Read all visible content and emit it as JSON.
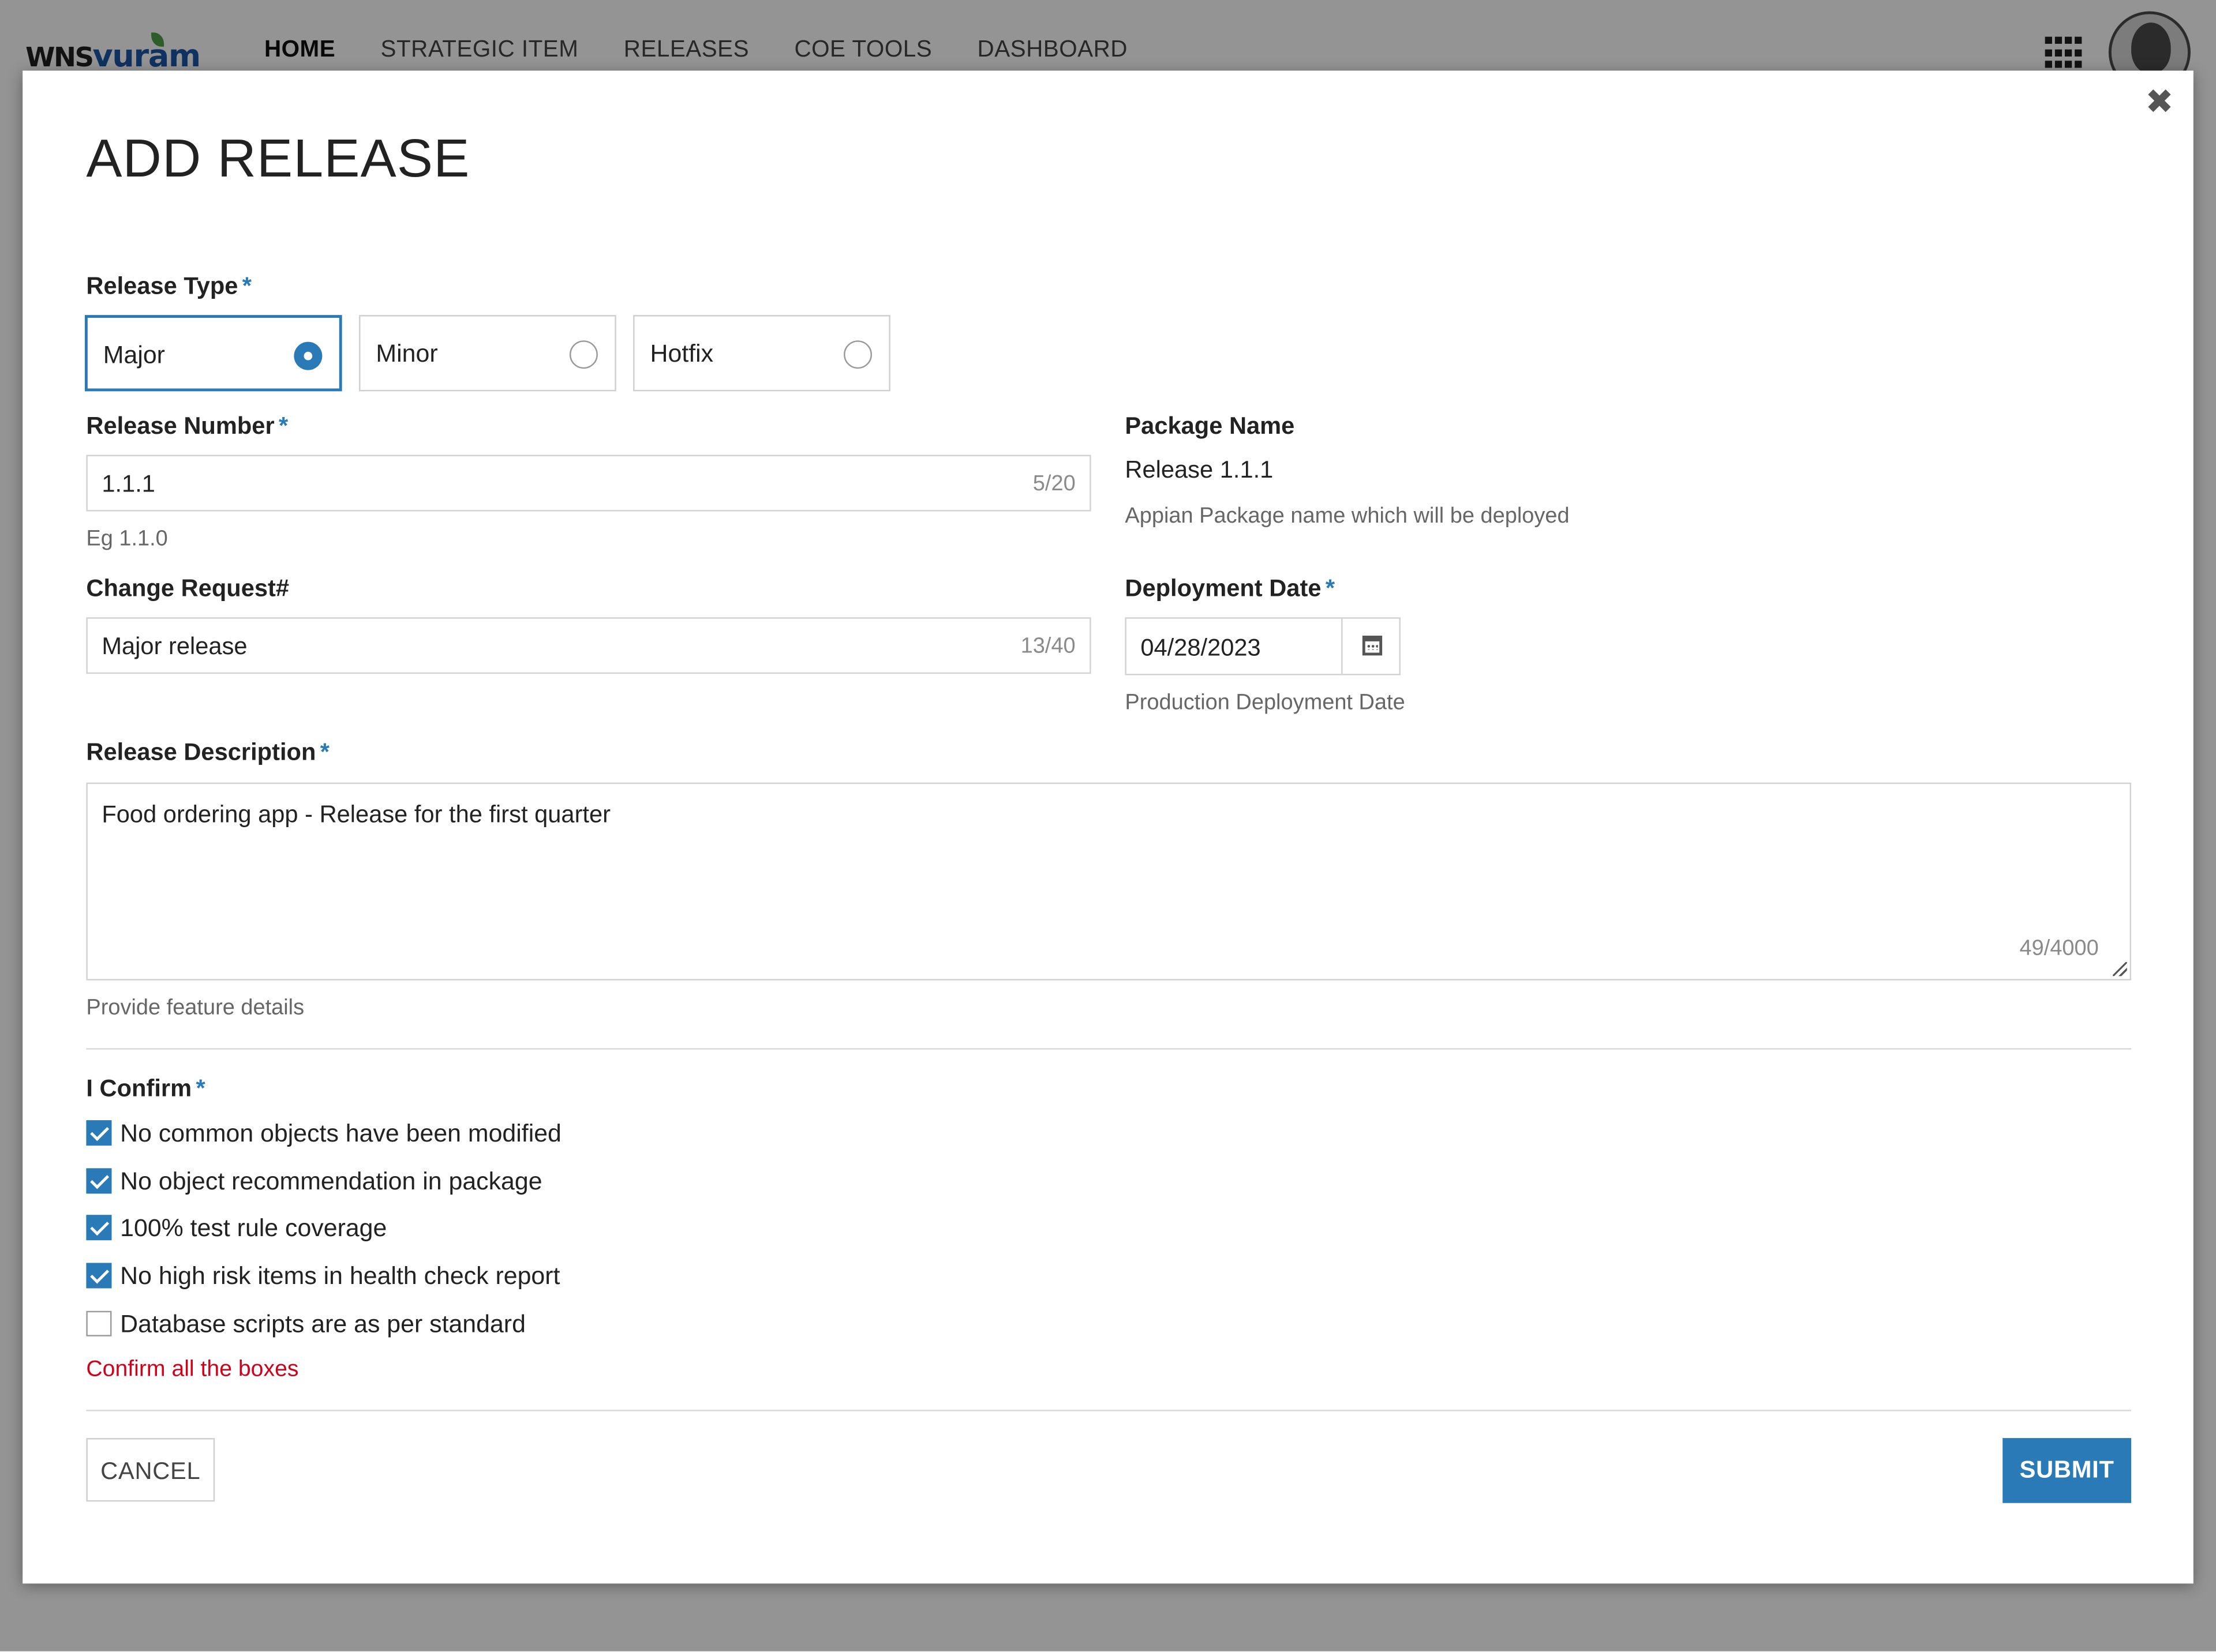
{
  "header": {
    "logo_wns": "WNS",
    "logo_vuram": "vuram",
    "nav": [
      "HOME",
      "STRATEGIC ITEM",
      "RELEASES",
      "COE TOOLS",
      "DASHBOARD"
    ]
  },
  "modal": {
    "title": "ADD RELEASE",
    "close_icon": "close-icon",
    "release_type": {
      "label": "Release Type",
      "required": "*",
      "options": [
        "Major",
        "Minor",
        "Hotfix"
      ],
      "selected": "Major"
    },
    "release_number": {
      "label": "Release Number",
      "required": "*",
      "value": "1.1.1",
      "count": "5/20",
      "help": "Eg 1.1.0"
    },
    "package_name": {
      "label": "Package Name",
      "value": "Release 1.1.1",
      "help": "Appian Package name which will be deployed"
    },
    "change_request": {
      "label": "Change Request#",
      "value": "Major release",
      "count": "13/40"
    },
    "deployment_date": {
      "label": "Deployment Date",
      "required": "*",
      "value": "04/28/2023",
      "help": "Production Deployment Date",
      "icon": "calendar-icon"
    },
    "release_description": {
      "label": "Release Description",
      "required": "*",
      "value": "Food ordering app - Release for the first quarter",
      "count": "49/4000",
      "help": "Provide feature details"
    },
    "confirm": {
      "label": "I Confirm",
      "required": "*",
      "items": [
        {
          "label": "No common objects have been modified",
          "checked": true
        },
        {
          "label": "No object recommendation in package",
          "checked": true
        },
        {
          "label": "100% test rule coverage",
          "checked": true
        },
        {
          "label": "No high risk items in health check report",
          "checked": true
        },
        {
          "label": "Database scripts are as per standard",
          "checked": false
        }
      ],
      "error": "Confirm all the boxes"
    },
    "buttons": {
      "cancel": "CANCEL",
      "submit": "SUBMIT"
    }
  },
  "colors": {
    "accent": "#2a7ab8",
    "error": "#d0021b",
    "overlay": "rgba(0,0,0,0.42)"
  }
}
